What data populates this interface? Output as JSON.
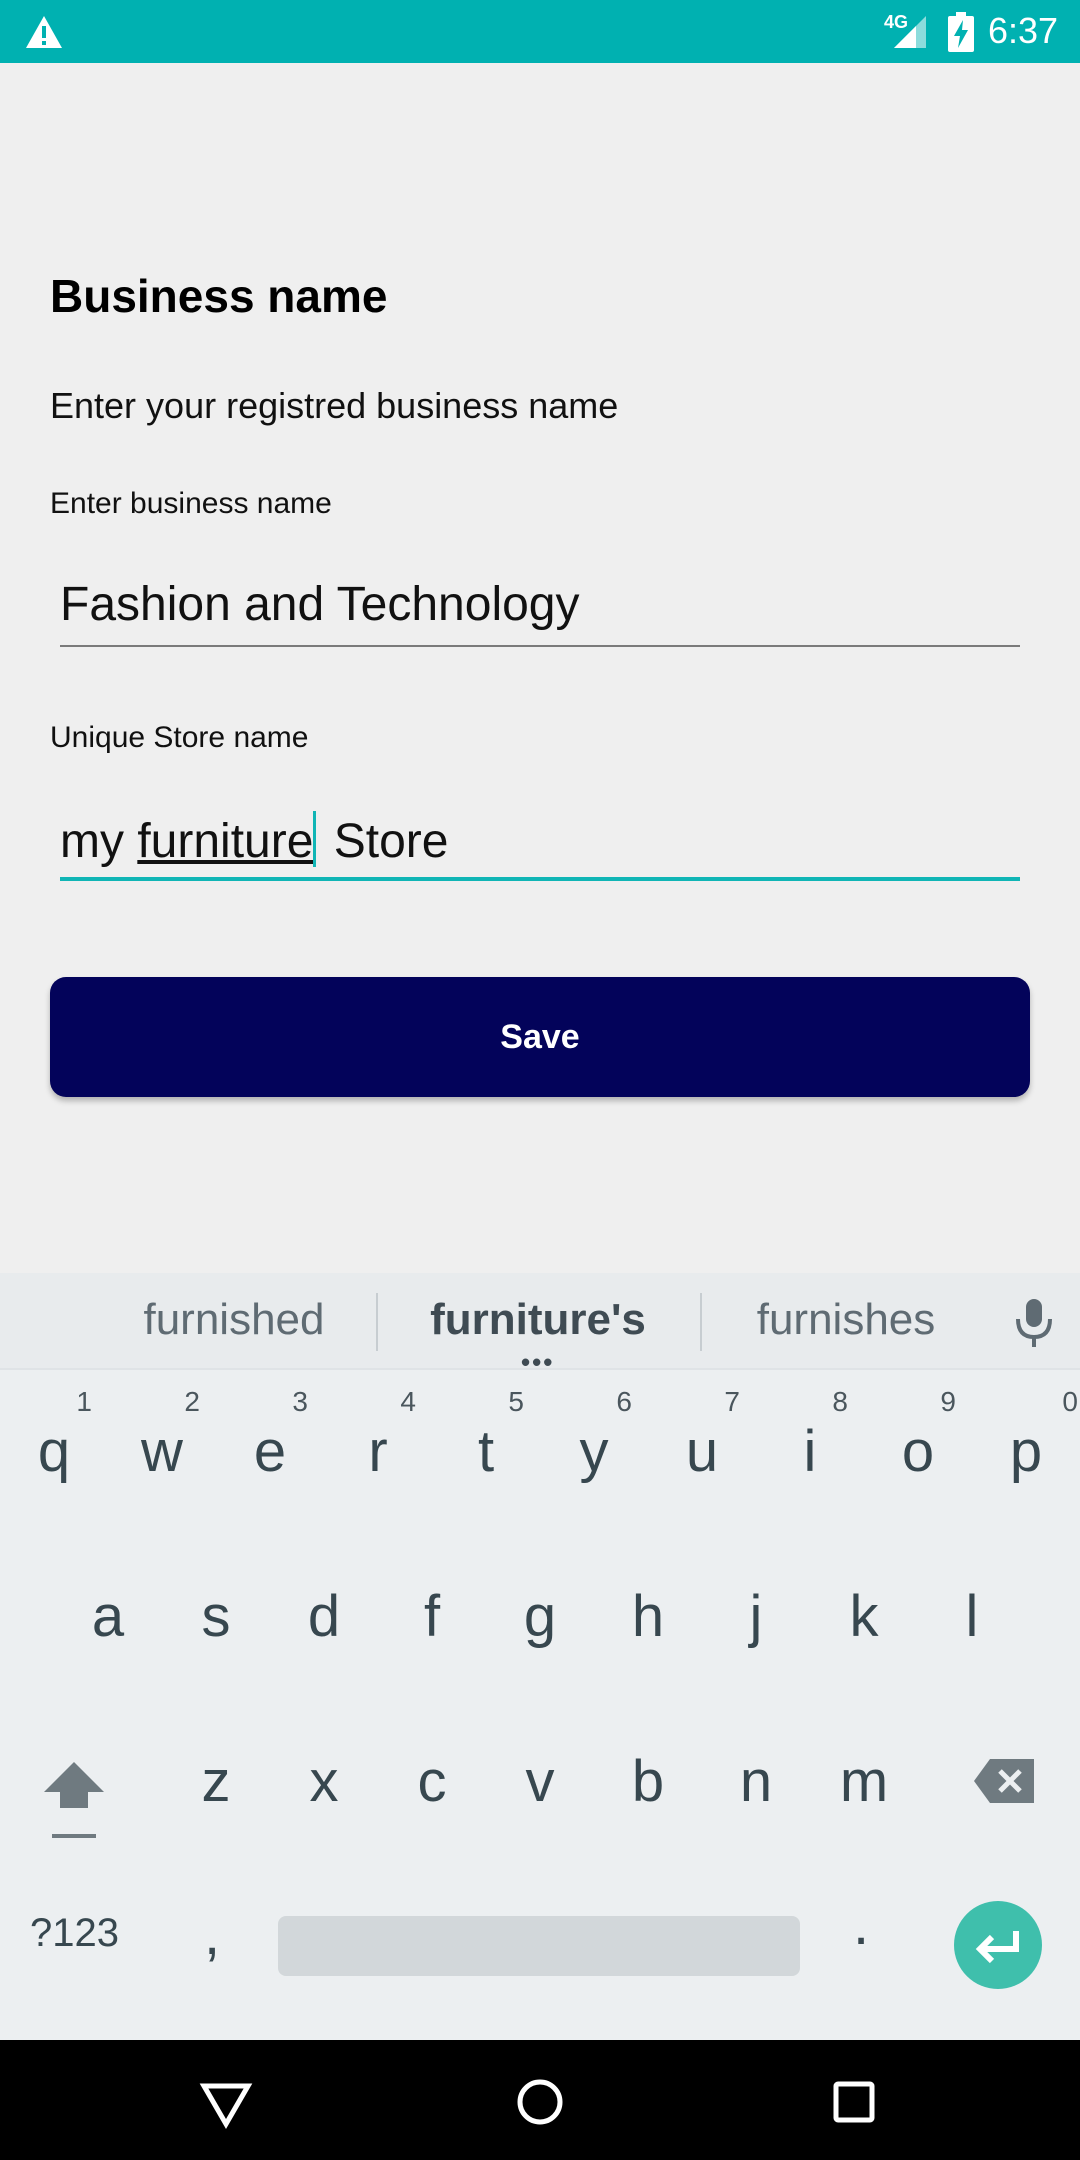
{
  "status_bar": {
    "network_type": "4G",
    "time": "6:37",
    "icons": [
      "warning-icon",
      "signal-icon",
      "battery-charging-icon"
    ]
  },
  "form": {
    "title": "Business name",
    "subtitle": "Enter your registred business name",
    "business_label": "Enter business name",
    "business_value": "Fashion and Technology",
    "store_label": "Unique Store name",
    "store_value_before": "my ",
    "store_value_composing": "furniture",
    "store_value_after": " Store",
    "save_label": "Save"
  },
  "keyboard": {
    "suggestions": [
      "furnished",
      "furniture's",
      "furnishes"
    ],
    "more_indicator": "•••",
    "row1": [
      {
        "key": "q",
        "hint": "1"
      },
      {
        "key": "w",
        "hint": "2"
      },
      {
        "key": "e",
        "hint": "3"
      },
      {
        "key": "r",
        "hint": "4"
      },
      {
        "key": "t",
        "hint": "5"
      },
      {
        "key": "y",
        "hint": "6"
      },
      {
        "key": "u",
        "hint": "7"
      },
      {
        "key": "i",
        "hint": "8"
      },
      {
        "key": "o",
        "hint": "9"
      },
      {
        "key": "p",
        "hint": "0"
      }
    ],
    "row2": [
      "a",
      "s",
      "d",
      "f",
      "g",
      "h",
      "j",
      "k",
      "l"
    ],
    "row3": [
      "z",
      "x",
      "c",
      "v",
      "b",
      "n",
      "m"
    ],
    "symbols_label": "?123",
    "comma": ",",
    "period": ".",
    "accent_color": "#3fbfac"
  },
  "colors": {
    "status_bar": "#00b1b1",
    "primary_button": "#03035a",
    "field_focus": "#10b5b5"
  }
}
